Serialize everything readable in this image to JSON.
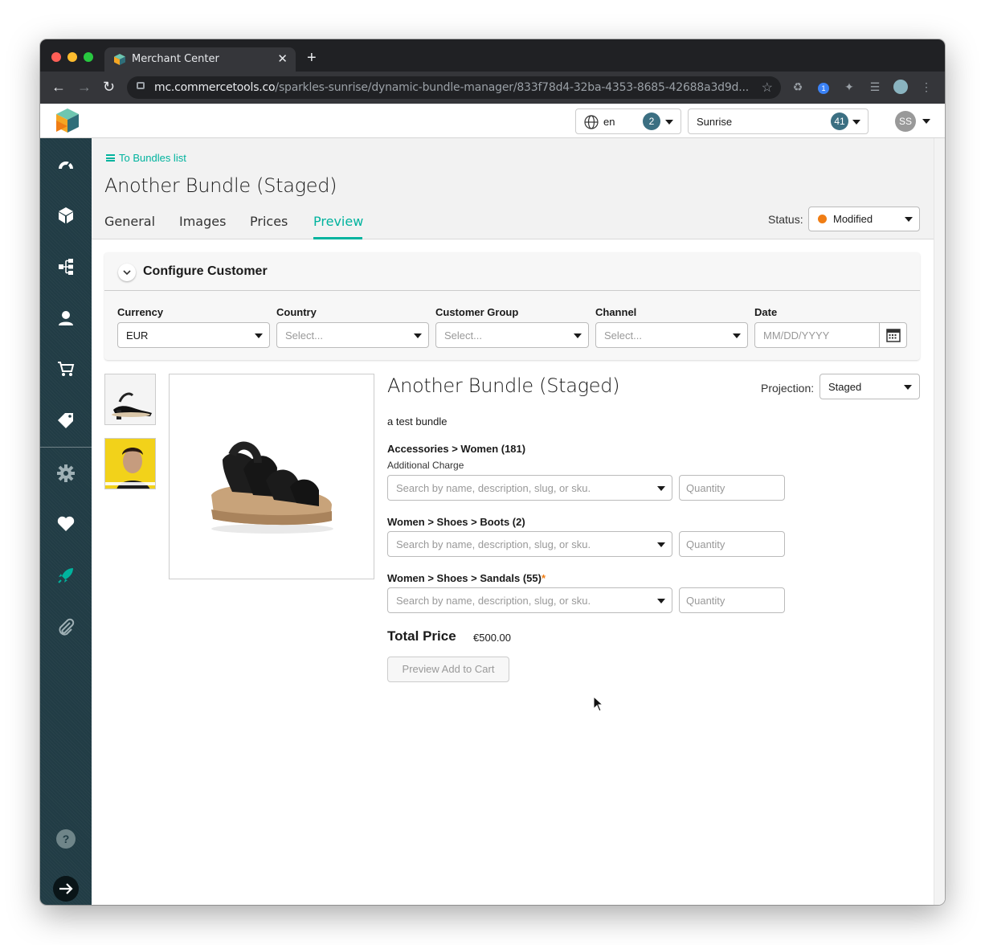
{
  "browser": {
    "tab_title": "Merchant Center",
    "url_host": "mc.commercetools.co",
    "url_path": "/sparkles-sunrise/dynamic-bundle-manager/833f78d4-32ba-4353-8685-42688a3d9d..."
  },
  "header": {
    "language": "en",
    "language_count": "2",
    "project": "Sunrise",
    "project_count": "41",
    "user_initials": "SS"
  },
  "sidebar": {
    "items": [
      {
        "icon": "dashboard-icon"
      },
      {
        "icon": "products-icon"
      },
      {
        "icon": "categories-icon"
      },
      {
        "icon": "customers-icon"
      },
      {
        "icon": "orders-icon"
      },
      {
        "icon": "discounts-icon"
      },
      {
        "icon": "settings-icon"
      },
      {
        "icon": "heart-icon"
      },
      {
        "icon": "rocket-icon"
      },
      {
        "icon": "paperclip-icon"
      },
      {
        "icon": "help-icon"
      },
      {
        "icon": "arrow-right-icon"
      }
    ]
  },
  "page": {
    "back_link": "To Bundles list",
    "title": "Another Bundle (Staged)",
    "tabs": [
      {
        "label": "General",
        "active": false
      },
      {
        "label": "Images",
        "active": false
      },
      {
        "label": "Prices",
        "active": false
      },
      {
        "label": "Preview",
        "active": true
      }
    ],
    "status_label": "Status:",
    "status_value": "Modified",
    "status_color": "#f07d14",
    "accent_color": "#00b39e"
  },
  "configure": {
    "title": "Configure Customer",
    "fields": {
      "currency": {
        "label": "Currency",
        "value": "EUR"
      },
      "country": {
        "label": "Country",
        "placeholder": "Select..."
      },
      "customer_group": {
        "label": "Customer Group",
        "placeholder": "Select..."
      },
      "channel": {
        "label": "Channel",
        "placeholder": "Select..."
      },
      "date": {
        "label": "Date",
        "placeholder": "MM/DD/YYYY"
      }
    }
  },
  "product": {
    "title": "Another Bundle (Staged)",
    "description": "a test bundle",
    "projection_label": "Projection:",
    "projection_value": "Staged",
    "categories": [
      {
        "label": "Accessories > Women (181)",
        "sub_label": "Additional Charge",
        "required": false
      },
      {
        "label": "Women > Shoes > Boots (2)",
        "required": false
      },
      {
        "label": "Women > Shoes > Sandals (55)",
        "required": true,
        "required_mark": "*"
      }
    ],
    "search_placeholder": "Search by name, description, slug, or sku.",
    "quantity_placeholder": "Quantity",
    "total_label": "Total Price",
    "total_value": "€500.00",
    "preview_button": "Preview Add to Cart"
  }
}
